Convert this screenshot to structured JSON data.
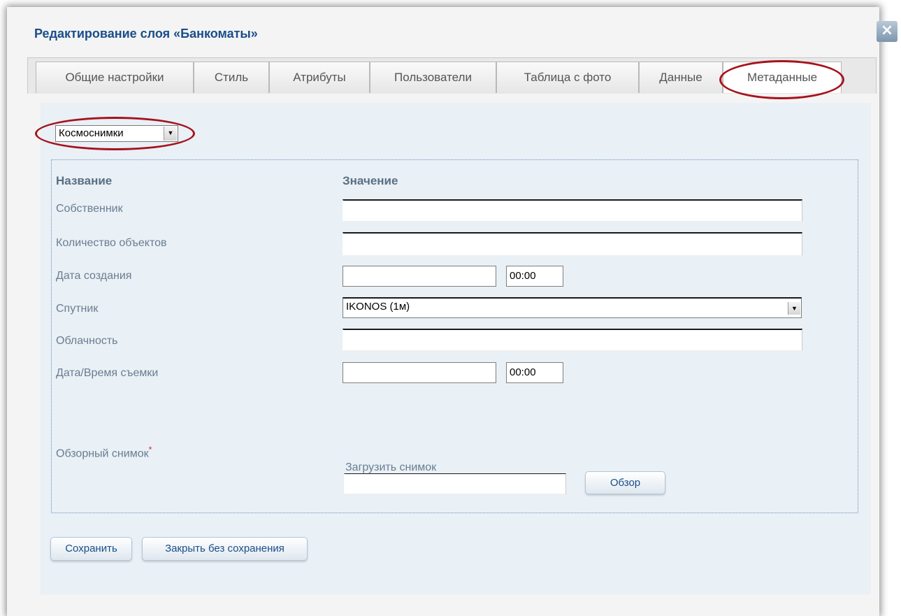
{
  "dialog": {
    "title": "Редактирование слоя «Банкоматы»",
    "close_label": "×"
  },
  "tabs": [
    {
      "label": "Общие настройки"
    },
    {
      "label": "Стиль"
    },
    {
      "label": "Атрибуты"
    },
    {
      "label": "Пользователи"
    },
    {
      "label": "Таблица с фото"
    },
    {
      "label": "Данные"
    },
    {
      "label": "Метаданные",
      "active": true
    }
  ],
  "metadata_type": {
    "selected": "Космоснимки"
  },
  "table": {
    "header_name": "Название",
    "header_value": "Значение",
    "rows": {
      "owner": {
        "label": "Собственник",
        "value": ""
      },
      "object_count": {
        "label": "Количество объектов",
        "value": ""
      },
      "created": {
        "label": "Дата создания",
        "date": "",
        "time": "00:00"
      },
      "satellite": {
        "label": "Спутник",
        "selected": "IKONOS (1м)"
      },
      "cloudiness": {
        "label": "Облачность",
        "value": ""
      },
      "shot_datetime": {
        "label": "Дата/Время съемки",
        "date": "",
        "time": "00:00"
      },
      "preview": {
        "label": "Обзорный снимок",
        "required_mark": "*"
      }
    },
    "upload": {
      "label": "Загрузить снимок",
      "file_value": "",
      "browse_label": "Обзор"
    }
  },
  "actions": {
    "save_label": "Сохранить",
    "close_no_save_label": "Закрыть без сохранения"
  },
  "colors": {
    "title": "#1a4e89",
    "highlight": "#a6131d",
    "panel": "#e9f0f6"
  }
}
